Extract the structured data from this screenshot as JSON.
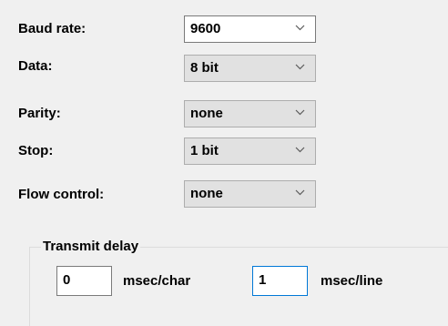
{
  "settings": {
    "baud": {
      "label": "Baud rate:",
      "value": "9600"
    },
    "data": {
      "label": "Data:",
      "value": "8 bit"
    },
    "parity": {
      "label": "Parity:",
      "value": "none"
    },
    "stop": {
      "label": "Stop:",
      "value": "1 bit"
    },
    "flow": {
      "label": "Flow control:",
      "value": "none"
    }
  },
  "transmit_delay": {
    "title": "Transmit delay",
    "char_delay": {
      "value": "0",
      "unit": "msec/char"
    },
    "line_delay": {
      "value": "1",
      "unit": "msec/line"
    }
  },
  "icons": {
    "dropdown": "chevron-down-icon"
  }
}
